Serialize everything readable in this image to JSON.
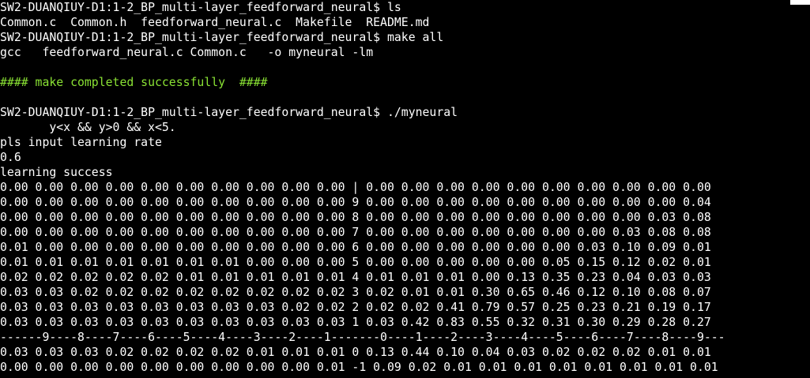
{
  "terminal": {
    "background": "#000000",
    "text_color": "#ffffff",
    "success_color": "#8ae234",
    "lines": [
      {
        "text": "SW2-DUANQIUY-D1:1-2_BP_multi-layer_feedforward_neural$ ls",
        "style": "normal"
      },
      {
        "text": "Common.c  Common.h  feedforward_neural.c  Makefile  README.md",
        "style": "normal"
      },
      {
        "text": "SW2-DUANQIUY-D1:1-2_BP_multi-layer_feedforward_neural$ make all",
        "style": "normal"
      },
      {
        "text": "gcc   feedforward_neural.c Common.c   -o myneural -lm",
        "style": "normal"
      },
      {
        "text": "",
        "style": "normal"
      },
      {
        "text": "#### make completed successfully  ####",
        "style": "green"
      },
      {
        "text": "",
        "style": "normal"
      },
      {
        "text": "SW2-DUANQIUY-D1:1-2_BP_multi-layer_feedforward_neural$ ./myneural",
        "style": "normal"
      },
      {
        "text": "       y<x && y>0 && x<5.",
        "style": "normal"
      },
      {
        "text": "pls input learning rate",
        "style": "normal"
      },
      {
        "text": "0.6",
        "style": "normal"
      },
      {
        "text": "learning success",
        "style": "normal"
      },
      {
        "text": "0.00 0.00 0.00 0.00 0.00 0.00 0.00 0.00 0.00 0.00 | 0.00 0.00 0.00 0.00 0.00 0.00 0.00 0.00 0.00 0.00",
        "style": "normal"
      },
      {
        "text": "0.00 0.00 0.00 0.00 0.00 0.00 0.00 0.00 0.00 0.00 9 0.00 0.00 0.00 0.00 0.00 0.00 0.00 0.00 0.00 0.04",
        "style": "normal"
      },
      {
        "text": "0.00 0.00 0.00 0.00 0.00 0.00 0.00 0.00 0.00 0.00 8 0.00 0.00 0.00 0.00 0.00 0.00 0.00 0.00 0.03 0.08",
        "style": "normal"
      },
      {
        "text": "0.00 0.00 0.00 0.00 0.00 0.00 0.00 0.00 0.00 0.00 7 0.00 0.00 0.00 0.00 0.00 0.00 0.00 0.03 0.08 0.08",
        "style": "normal"
      },
      {
        "text": "0.01 0.00 0.00 0.00 0.00 0.00 0.00 0.00 0.00 0.00 6 0.00 0.00 0.00 0.00 0.00 0.00 0.03 0.10 0.09 0.01",
        "style": "normal"
      },
      {
        "text": "0.01 0.01 0.01 0.01 0.01 0.01 0.01 0.00 0.00 0.00 5 0.00 0.00 0.00 0.00 0.00 0.05 0.15 0.12 0.02 0.01",
        "style": "normal"
      },
      {
        "text": "0.02 0.02 0.02 0.02 0.02 0.01 0.01 0.01 0.01 0.01 4 0.01 0.01 0.01 0.00 0.13 0.35 0.23 0.04 0.03 0.03",
        "style": "normal"
      },
      {
        "text": "0.03 0.03 0.02 0.02 0.02 0.02 0.02 0.02 0.02 0.02 3 0.02 0.01 0.01 0.30 0.65 0.46 0.12 0.10 0.08 0.07",
        "style": "normal"
      },
      {
        "text": "0.03 0.03 0.03 0.03 0.03 0.03 0.03 0.03 0.02 0.02 2 0.02 0.02 0.41 0.79 0.57 0.25 0.23 0.21 0.19 0.17",
        "style": "normal"
      },
      {
        "text": "0.03 0.03 0.03 0.03 0.03 0.03 0.03 0.03 0.03 0.03 1 0.03 0.42 0.83 0.55 0.32 0.31 0.30 0.29 0.28 0.27",
        "style": "normal"
      },
      {
        "text": "------9----8----7----6----5----4----3----2----1-------0----1----2----3----4----5----6----7----8----9---",
        "style": "normal"
      },
      {
        "text": "0.03 0.03 0.03 0.02 0.02 0.02 0.02 0.01 0.01 0.01 0 0.13 0.44 0.10 0.04 0.03 0.02 0.02 0.02 0.01 0.01",
        "style": "normal"
      },
      {
        "text": "0.00 0.00 0.00 0.00 0.00 0.00 0.00 0.00 0.00 0.01 -1 0.09 0.02 0.01 0.01 0.01 0.01 0.01 0.01 0.01 0.01",
        "style": "normal"
      }
    ]
  }
}
